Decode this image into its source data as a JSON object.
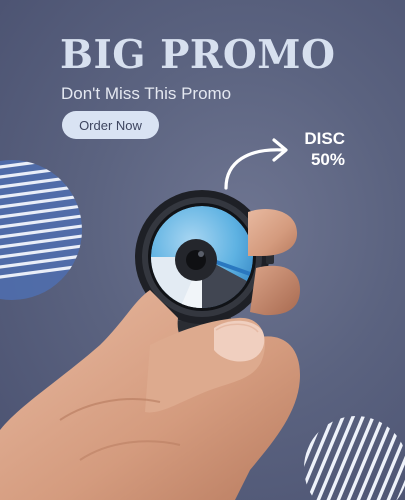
{
  "promo": {
    "title": "BIG PROMO",
    "subtitle": "Don't Miss This Promo",
    "order_button_label": "Order Now",
    "discount_line1": "DISC",
    "discount_line2": "50%"
  },
  "colors": {
    "background": "#5b6380",
    "title": "#d7e0ef",
    "button_background": "#d9e3f3",
    "accent_blue": "#4aa3d8"
  },
  "icons": {
    "arrow": "curved-arrow-icon",
    "product": "wrist-watch-icon"
  }
}
